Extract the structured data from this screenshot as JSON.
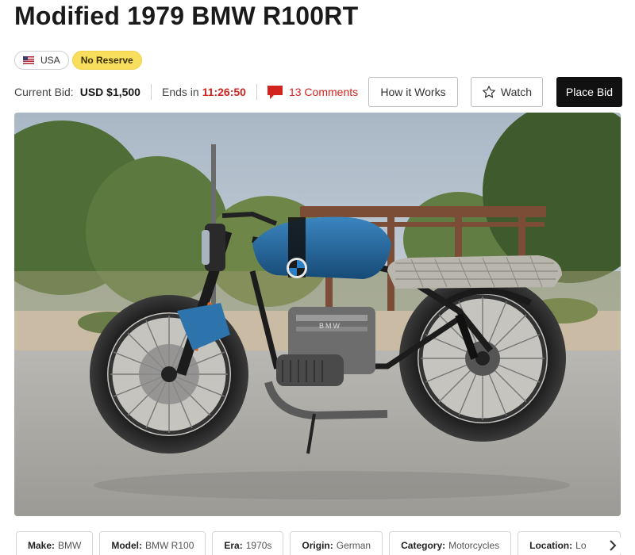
{
  "listing": {
    "title": "Modified 1979 BMW R100RT"
  },
  "badges": {
    "country": "USA",
    "reserve": "No Reserve"
  },
  "bid": {
    "current_label": "Current Bid:",
    "current_value": "USD $1,500",
    "ends_label": "Ends in",
    "ends_time": "11:26:50",
    "comments": "13 Comments"
  },
  "buttons": {
    "how_it_works": "How it Works",
    "watch": "Watch",
    "place_bid": "Place Bid"
  },
  "specs": [
    {
      "key": "Make:",
      "value": "BMW"
    },
    {
      "key": "Model:",
      "value": "BMW R100"
    },
    {
      "key": "Era:",
      "value": "1970s"
    },
    {
      "key": "Origin:",
      "value": "German"
    },
    {
      "key": "Category:",
      "value": "Motorcycles"
    },
    {
      "key": "Location:",
      "value": "Lo"
    }
  ],
  "hero_tank_emblem": "BMW",
  "hero_engine_text": "BMW",
  "colors": {
    "accent_red": "#d2231f",
    "reserve_yellow": "#f9dd5c",
    "tank_blue": "#1f5d8f",
    "place_bid_bg": "#111111"
  },
  "icons": [
    "flag-us-icon",
    "comment-icon",
    "star-icon",
    "chevron-right-icon"
  ]
}
